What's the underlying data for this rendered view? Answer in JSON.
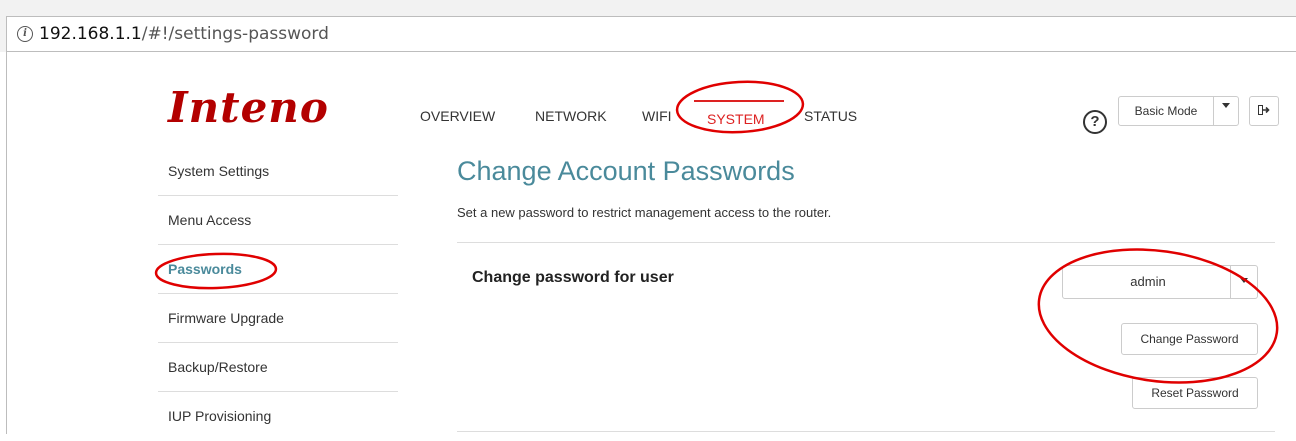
{
  "browser": {
    "info_icon": "i",
    "url_host": "192.168.1.1",
    "url_path": "/#!/settings-password"
  },
  "header": {
    "logo": "Inteno",
    "nav": [
      "OVERVIEW",
      "NETWORK",
      "WIFI",
      "SYSTEM",
      "STATUS"
    ],
    "active_nav": "SYSTEM",
    "help_icon": "?",
    "mode_label": "Basic Mode",
    "logout_icon": "logout-icon"
  },
  "sidebar": {
    "items": [
      {
        "label": "System Settings"
      },
      {
        "label": "Menu Access"
      },
      {
        "label": "Passwords"
      },
      {
        "label": "Firmware Upgrade"
      },
      {
        "label": "Backup/Restore"
      },
      {
        "label": "IUP Provisioning"
      }
    ],
    "active_index": 2
  },
  "main": {
    "title": "Change Account Passwords",
    "description": "Set a new password to restrict management access to the router.",
    "section_label": "Change password for user",
    "user_select_value": "admin",
    "change_button": "Change Password",
    "reset_button": "Reset Password"
  },
  "colors": {
    "accent": "#4a8a9b",
    "brand": "#b30000",
    "annotation": "#e00000"
  }
}
